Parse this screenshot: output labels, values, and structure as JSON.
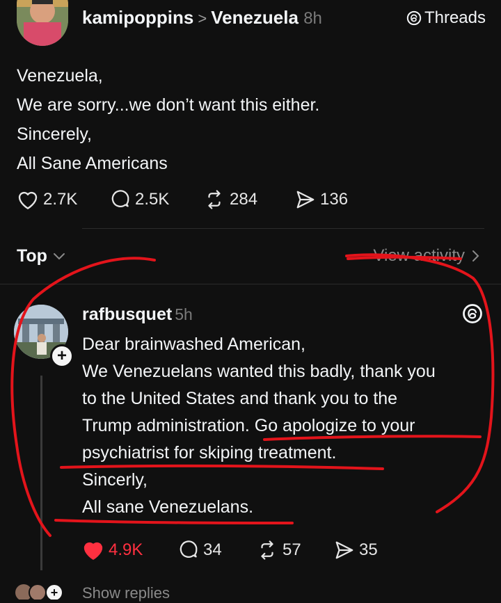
{
  "post": {
    "author": "kamipoppins",
    "separator": ">",
    "community": "Venezuela",
    "time": "8h",
    "badge_label": "Threads",
    "lines": [
      "Venezuela,",
      "We are sorry...we don’t want this either.",
      "Sincerely,",
      "All Sane Americans"
    ],
    "likes": "2.7K",
    "replies": "2.5K",
    "reposts": "284",
    "shares": "136"
  },
  "sort": {
    "label": "Top",
    "view_activity": "View activity"
  },
  "reply": {
    "author": "rafbusquet",
    "time": "5h",
    "lines": [
      "Dear brainwashed American,",
      "We Venezuelans wanted this badly, thank you",
      "to the United States and thank you to the",
      "Trump administration. Go apologize to your",
      "psychiatrist for skiping treatment.",
      "Sincerly,",
      "All sane Venezuelans."
    ],
    "likes": "4.9K",
    "replies": "34",
    "reposts": "57",
    "shares": "35",
    "show_replies": "Show replies"
  },
  "colors": {
    "background": "#101010",
    "liked": "#ff3040",
    "annotation": "#e3141b"
  },
  "icons": {
    "like": "heart-icon",
    "reply": "comment-icon",
    "repost": "repost-icon",
    "share": "send-icon",
    "threads": "threads-logo-icon"
  }
}
